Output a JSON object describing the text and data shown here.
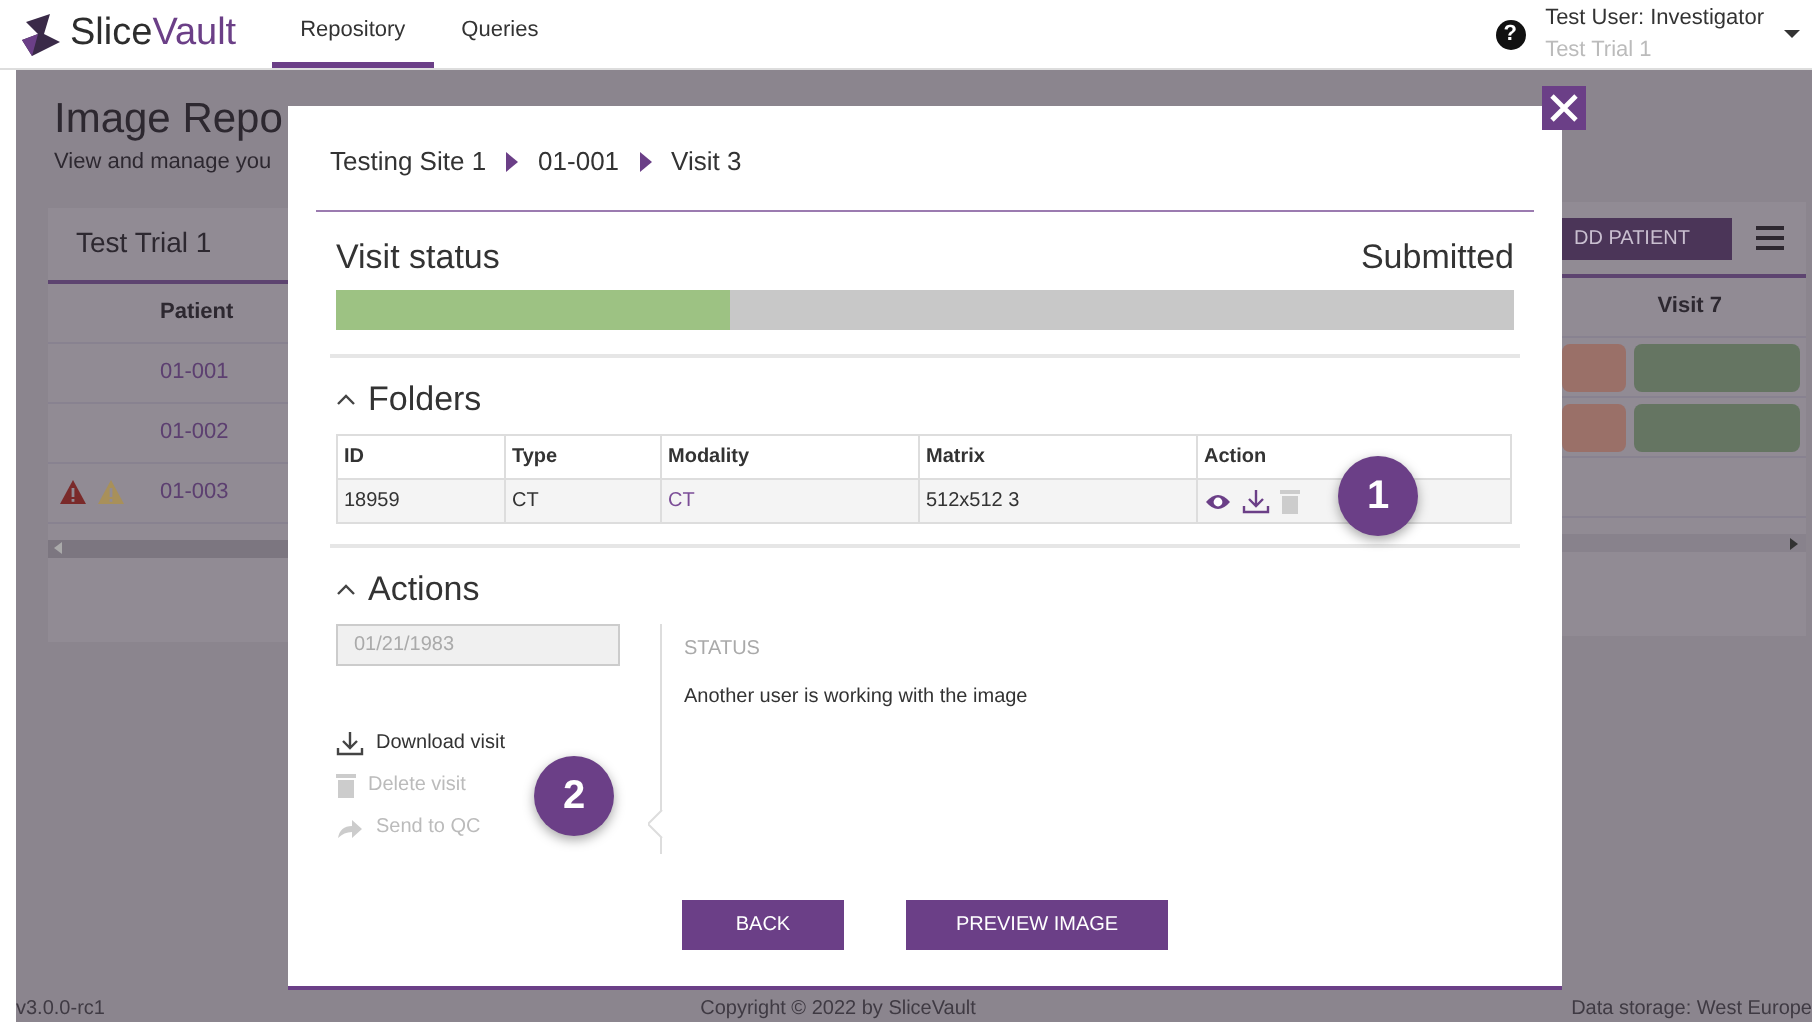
{
  "header": {
    "brand": [
      "Slice",
      "Vault"
    ],
    "nav": [
      {
        "label": "Repository",
        "selected": true
      },
      {
        "label": "Queries",
        "selected": false
      }
    ],
    "help": "?",
    "user": {
      "name": "Test User: Investigator",
      "trial": "Test Trial 1"
    }
  },
  "background": {
    "title": "Image Repo",
    "subtitle": "View and manage you",
    "card_title": "Test Trial 1",
    "add_button": "DD PATIENT",
    "patient_column": "Patient",
    "visit_column": "Visit 7",
    "rows": [
      {
        "patient": "01-001",
        "alerts": [],
        "cells": [
          {
            "color": "#9a7068"
          },
          {
            "color": "#657562"
          }
        ]
      },
      {
        "patient": "01-002",
        "alerts": [],
        "cells": [
          {
            "color": "#9a7068"
          },
          {
            "color": "#657562"
          }
        ]
      },
      {
        "patient": "01-003",
        "alerts": [
          {
            "kind": "error"
          },
          {
            "kind": "warning"
          }
        ],
        "cells": []
      }
    ]
  },
  "modal": {
    "breadcrumb": [
      "Testing Site 1",
      "01-001",
      "Visit 3"
    ],
    "visit_status": {
      "label": "Visit status",
      "value": "Submitted",
      "level": 0.335
    },
    "folders": {
      "title": "Folders",
      "expanded": true,
      "columns": [
        "ID",
        "Type",
        "Modality",
        "Matrix",
        "Action"
      ],
      "rows": [
        {
          "cells": [
            "18959",
            "CT",
            "CT",
            "512x512 3"
          ],
          "actions": [
            {
              "kind": "view",
              "disabled": false
            },
            {
              "kind": "download",
              "disabled": false
            },
            {
              "kind": "delete",
              "disabled": true
            }
          ]
        }
      ]
    },
    "actions": {
      "title": "Actions",
      "expanded": true,
      "date": {
        "value": "01/21/1983",
        "disabled": true
      },
      "items": [
        {
          "kind": "download",
          "label": "Download visit",
          "disabled": false
        },
        {
          "kind": "delete",
          "label": "Delete visit",
          "disabled": true
        },
        {
          "kind": "send",
          "label": "Send to QC",
          "disabled": true
        }
      ],
      "status_label": "STATUS",
      "status_text": "Another user is working with the image"
    },
    "buttons": [
      "BACK",
      "PREVIEW IMAGE"
    ],
    "callouts": [
      "1",
      "2"
    ]
  },
  "footer": {
    "version": "v3.0.0-rc1",
    "copyright": "Copyright © 2022 by SliceVault",
    "storage": "Data storage: West Europe"
  }
}
